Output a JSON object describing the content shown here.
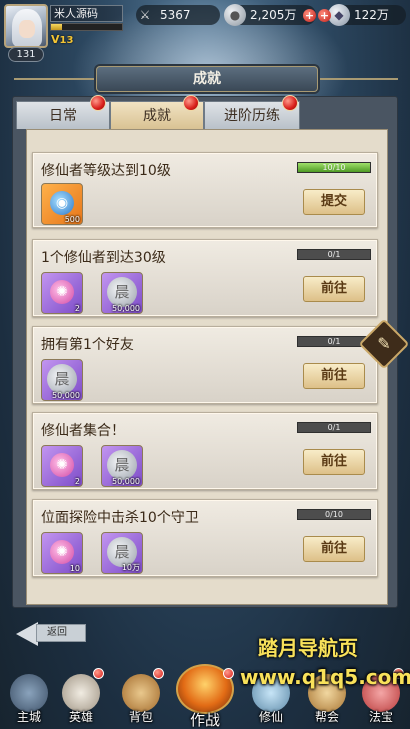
{
  "player": {
    "name": "米人源码",
    "level": "131",
    "vip_label": "V",
    "vip_level": "13",
    "exp_fraction": 0.15
  },
  "resources": {
    "power": "5367",
    "silver": "2,205万",
    "gem": "122万",
    "plus": "+"
  },
  "window": {
    "title": "成就"
  },
  "tabs": [
    {
      "label": "日常"
    },
    {
      "label": "成就",
      "selected": true
    },
    {
      "label": "进阶历练"
    }
  ],
  "achievements": [
    {
      "title": "修仙者等级达到10级",
      "progress": "10/10",
      "progress_fraction": 1.0,
      "button": "提交",
      "rewards": [
        {
          "icon": "blue-orb-item-icon",
          "qty": "500",
          "glyph": "◉"
        }
      ]
    },
    {
      "title": "1个修仙者到达30级",
      "progress": "0/1",
      "progress_fraction": 0,
      "button": "前往",
      "rewards": [
        {
          "icon": "spirit-item-icon",
          "qty": "2",
          "glyph": "✺"
        },
        {
          "icon": "silver-coin-icon",
          "qty": "50,000",
          "glyph": "晨"
        }
      ]
    },
    {
      "title": "拥有第1个好友",
      "progress": "0/1",
      "progress_fraction": 0,
      "button": "前往",
      "rewards": [
        {
          "icon": "silver-coin-icon",
          "qty": "50,000",
          "glyph": "晨"
        }
      ]
    },
    {
      "title": "修仙者集合！",
      "progress": "0/1",
      "progress_fraction": 0,
      "button": "前往",
      "rewards": [
        {
          "icon": "spirit-item-icon",
          "qty": "2",
          "glyph": "✺"
        },
        {
          "icon": "silver-coin-icon",
          "qty": "50,000",
          "glyph": "晨"
        }
      ]
    },
    {
      "title": "位面探险中击杀10个守卫",
      "progress": "0/10",
      "progress_fraction": 0,
      "button": "前往",
      "rewards": [
        {
          "icon": "spirit-item-icon",
          "qty": "10",
          "glyph": "✺"
        },
        {
          "icon": "silver-coin-icon",
          "qty": "10万",
          "glyph": "晨"
        }
      ]
    }
  ],
  "back_label": "返回",
  "watermark": {
    "title": "踏月导航页",
    "url": "www.q1q5.com"
  },
  "nav": [
    {
      "label": "主城"
    },
    {
      "label": "英雄"
    },
    {
      "label": "背包"
    },
    {
      "label": "作战"
    },
    {
      "label": "修仙"
    },
    {
      "label": "帮会"
    },
    {
      "label": "法宝"
    }
  ],
  "colors": {
    "accent_red": "#d81e1a",
    "button_gold": "#ddc088",
    "progress_green": "#4f9a24"
  }
}
